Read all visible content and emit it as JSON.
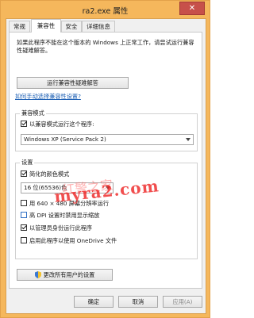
{
  "window": {
    "title": "ra2.exe 属性",
    "close_glyph": "✕"
  },
  "tabs": [
    {
      "label": "常规",
      "active": false
    },
    {
      "label": "兼容性",
      "active": true
    },
    {
      "label": "安全",
      "active": false
    },
    {
      "label": "详细信息",
      "active": false
    }
  ],
  "compat": {
    "intro": "如果此程序不能在这个版本的 Windows 上正常工作，请尝试运行兼容性疑难解答。",
    "troubleshoot_button": "运行兼容性疑难解答",
    "manual_link": "如何手动选择兼容性设置?",
    "mode_group_title": "兼容模式",
    "mode_checkbox_label": "以兼容模式运行这个程序:",
    "mode_checked": true,
    "mode_select_value": "Windows XP (Service Pack 2)"
  },
  "settings": {
    "group_title": "设置",
    "reduced_color_label": "简化的颜色模式",
    "reduced_color_checked": true,
    "color_select_value": "16 位(65536)色",
    "res640_label": "用 640 × 480 屏幕分辨率运行",
    "res640_checked": false,
    "dpi_label": "高 DPI 设置时禁用显示缩放",
    "dpi_checked": false,
    "admin_label": "以管理员身份运行此程序",
    "admin_checked": true,
    "onedrive_label": "启用此程序以使用 OneDrive 文件",
    "onedrive_checked": false
  },
  "all_users_button": "更改所有用户的设置",
  "footer": {
    "ok": "确定",
    "cancel": "取消",
    "apply": "应用(A)"
  },
  "watermark": {
    "text": "myra2.com",
    "sub": "红警之家"
  }
}
